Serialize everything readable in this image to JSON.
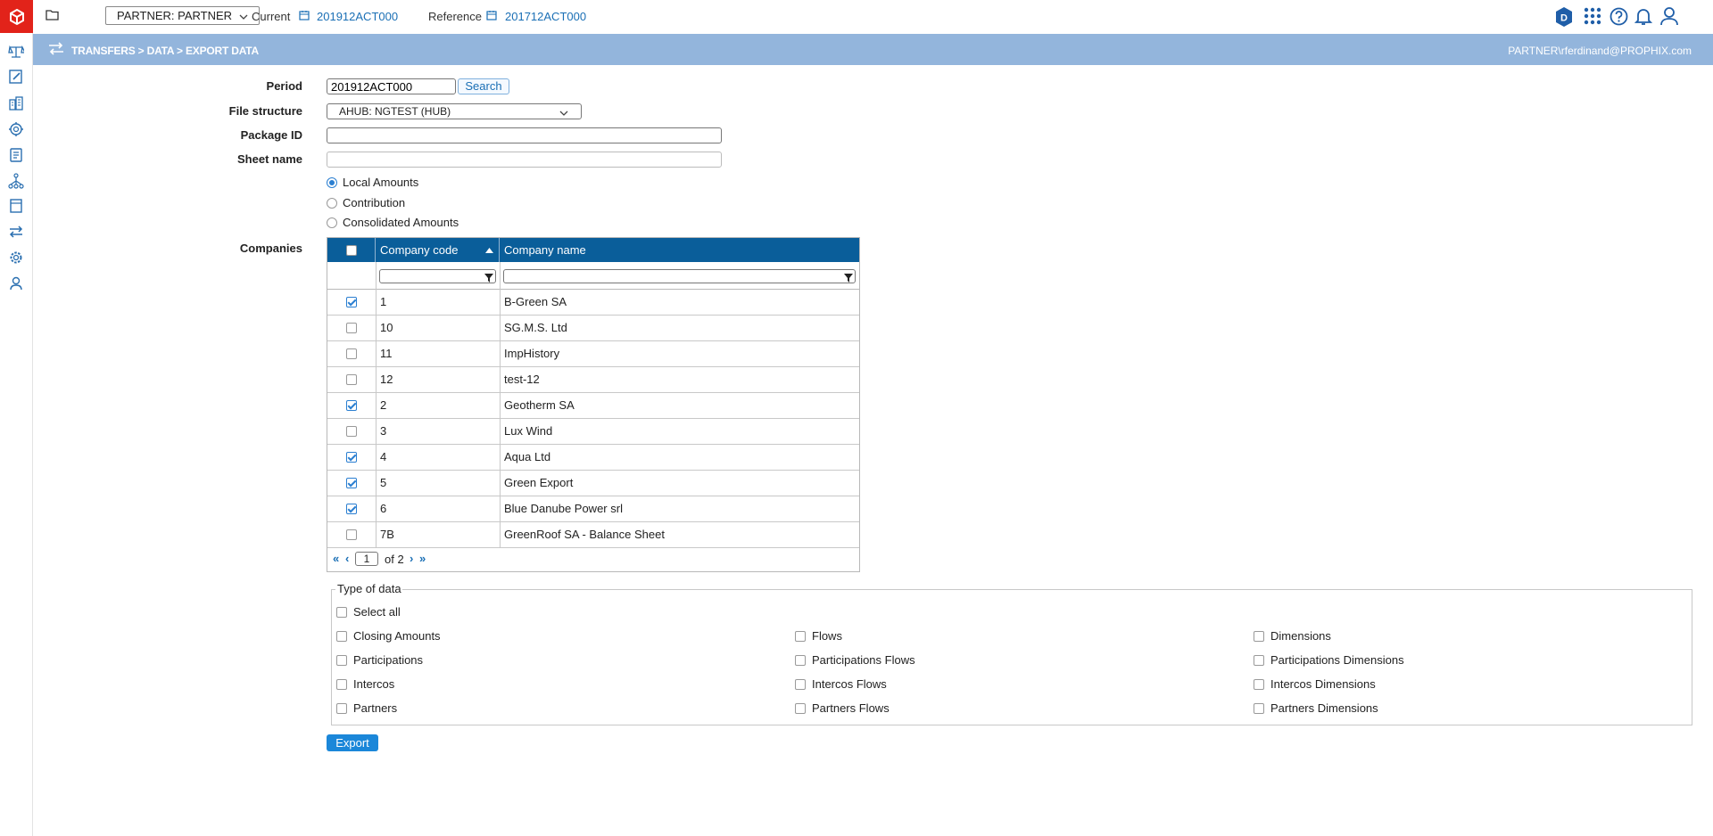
{
  "topbar": {
    "partner_select": "PARTNER: PARTNER",
    "current_label": "Current",
    "current_value": "201912ACT000",
    "reference_label": "Reference",
    "reference_value": "201712ACT000",
    "badge_letter": "D"
  },
  "header": {
    "breadcrumb": "TRANSFERS > DATA > EXPORT DATA",
    "user": "PARTNER\\rferdinand@PROPHIX.com"
  },
  "form": {
    "period_label": "Period",
    "period_value": "201912ACT000",
    "search_button": "Search",
    "file_structure_label": "File structure",
    "file_structure_value": "AHUB: NGTEST (HUB)",
    "package_id_label": "Package ID",
    "package_id_value": "",
    "sheet_name_label": "Sheet name",
    "sheet_name_value": "",
    "amount_options": [
      {
        "label": "Local Amounts",
        "selected": true
      },
      {
        "label": "Contribution",
        "selected": false
      },
      {
        "label": "Consolidated Amounts",
        "selected": false
      }
    ],
    "companies_label": "Companies"
  },
  "grid": {
    "col_code": "Company code",
    "col_name": "Company name",
    "rows": [
      {
        "code": "1",
        "name": "B-Green SA",
        "checked": true
      },
      {
        "code": "10",
        "name": "SG.M.S. Ltd",
        "checked": false
      },
      {
        "code": "11",
        "name": "ImpHistory",
        "checked": false
      },
      {
        "code": "12",
        "name": "test-12",
        "checked": false
      },
      {
        "code": "2",
        "name": "Geotherm SA",
        "checked": true
      },
      {
        "code": "3",
        "name": "Lux Wind",
        "checked": false
      },
      {
        "code": "4",
        "name": "Aqua Ltd",
        "checked": true
      },
      {
        "code": "5",
        "name": "Green Export",
        "checked": true
      },
      {
        "code": "6",
        "name": "Blue Danube Power srl",
        "checked": true
      },
      {
        "code": "7B",
        "name": "GreenRoof SA - Balance Sheet",
        "checked": false
      }
    ],
    "pager": {
      "page": "1",
      "of_text": "of",
      "total": "2"
    }
  },
  "type_of_data": {
    "legend": "Type of data",
    "select_all": "Select all",
    "col1": [
      "Closing Amounts",
      "Participations",
      "Intercos",
      "Partners"
    ],
    "col2": [
      "Flows",
      "Participations Flows",
      "Intercos Flows",
      "Partners Flows"
    ],
    "col3": [
      "Dimensions",
      "Participations Dimensions",
      "Intercos Dimensions",
      "Partners Dimensions"
    ]
  },
  "export_button": "Export",
  "colors": {
    "accent": "#1b87d9",
    "header_bar": "#93b5dc",
    "grid_header": "#0a5e9a",
    "logo": "#e2231a"
  }
}
